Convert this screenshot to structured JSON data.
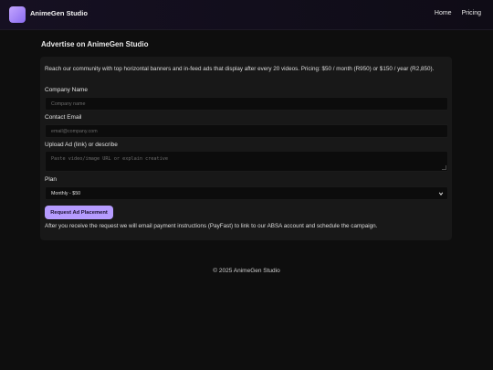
{
  "header": {
    "brand": "AnimeGen Studio",
    "nav": [
      "Home",
      "Pricing"
    ]
  },
  "page": {
    "title": "Advertise on AnimeGen Studio",
    "intro": "Reach our community with top horizontal banners and in-feed ads that display after every 20 videos. Pricing: $50 / month (R950) or $150 / year (R2,850)."
  },
  "form": {
    "company_label": "Company Name",
    "company_placeholder": "Company name",
    "email_label": "Contact Email",
    "email_placeholder": "email@company.com",
    "upload_label": "Upload Ad (link) or describe",
    "upload_placeholder": "Paste video/image URL or explain creative",
    "plan_label": "Plan",
    "plan_selected": "Monthly - $50",
    "submit_label": "Request Ad Placement",
    "after_text": "After you receive the request we will email payment instructions (PayFast) to link to our ABSA account and schedule the campaign."
  },
  "footer": {
    "text": "© 2025 AnimeGen Studio"
  },
  "colors": {
    "accent": "#b69cff",
    "background": "#0e0e0e",
    "card": "#181818"
  }
}
